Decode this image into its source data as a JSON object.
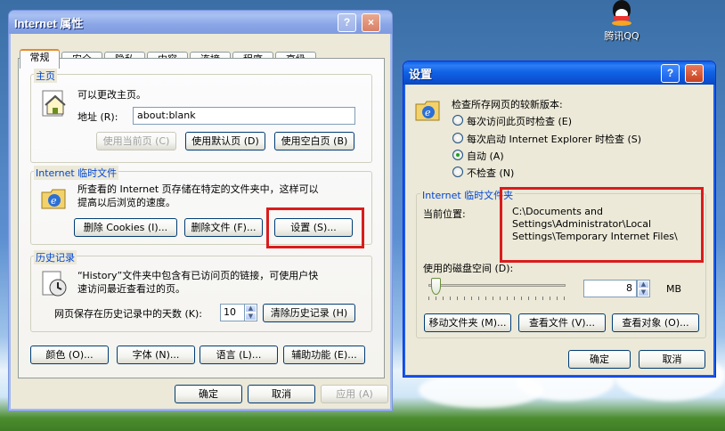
{
  "desktop": {
    "icon_label": "腾讯QQ"
  },
  "internet_options": {
    "title": "Internet 属性",
    "title_help": "?",
    "title_close": "×",
    "tabs": [
      "常规",
      "安全",
      "隐私",
      "内容",
      "连接",
      "程序",
      "高级"
    ],
    "homepage": {
      "group_label": "主页",
      "description": "可以更改主页。",
      "address_label": "地址 (R):",
      "address_value": "about:blank",
      "btn_current": "使用当前页 (C)",
      "btn_default": "使用默认页 (D)",
      "btn_blank": "使用空白页 (B)"
    },
    "temp_files": {
      "group_label": "Internet 临时文件",
      "description_line1": "所查看的 Internet 页存储在特定的文件夹中，这样可以",
      "description_line2": "提高以后浏览的速度。",
      "btn_delete_cookies": "删除 Cookies (I)...",
      "btn_delete_files": "删除文件 (F)...",
      "btn_settings": "设置 (S)..."
    },
    "history": {
      "group_label": "历史记录",
      "description_line1": "“History”文件夹中包含有已访问页的链接，可使用户快",
      "description_line2": "速访问最近查看过的页。",
      "days_label": "网页保存在历史记录中的天数 (K):",
      "days_value": "10",
      "btn_clear": "清除历史记录 (H)"
    },
    "bottom_buttons": {
      "colors": "颜色 (O)...",
      "fonts": "字体 (N)...",
      "languages": "语言 (L)...",
      "accessibility": "辅助功能 (E)..."
    },
    "dialog_buttons": {
      "ok": "确定",
      "cancel": "取消",
      "apply": "应用 (A)"
    }
  },
  "settings": {
    "title": "设置",
    "title_help": "?",
    "title_close": "×",
    "check_label": "检查所存网页的较新版本:",
    "options": [
      {
        "label": "每次访问此页时检查 (E)",
        "checked": false
      },
      {
        "label": "每次启动 Internet Explorer 时检查 (S)",
        "checked": false
      },
      {
        "label": "自动 (A)",
        "checked": true
      },
      {
        "label": "不检查 (N)",
        "checked": false
      }
    ],
    "temp_group_label": "Internet 临时文件夹",
    "location_label": "当前位置:",
    "location_lines": [
      "C:\\Documents and",
      "Settings\\Administrator\\Local",
      "Settings\\Temporary Internet Files\\"
    ],
    "disk_space_label": "使用的磁盘空间 (D):",
    "disk_space_value": "8",
    "disk_space_unit": "MB",
    "slider_level": 0.02,
    "btn_move": "移动文件夹 (M)...",
    "btn_view_files": "查看文件 (V)...",
    "btn_view_objects": "查看对象 (O)...",
    "ok": "确定",
    "cancel": "取消"
  },
  "colors": {
    "highlight": "#d91c1c",
    "group_label": "#0046d5",
    "title_active": "#0a5fe8"
  }
}
